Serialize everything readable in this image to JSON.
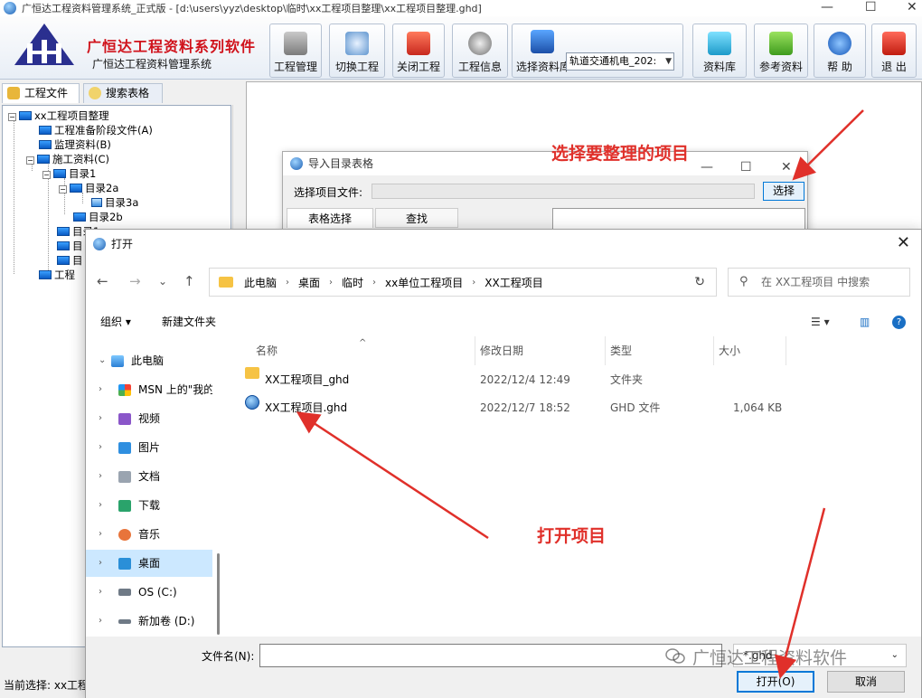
{
  "window": {
    "title": "广恒达工程资料管理系统_正式版 - [d:\\users\\yyz\\desktop\\临时\\xx工程项目整理\\xx工程项目整理.ghd]",
    "controls": [
      "—",
      "☐",
      "✕"
    ]
  },
  "brand": {
    "name": "广恒达工程资料系列软件",
    "subtitle": "广恒达工程资料管理系统"
  },
  "toolbar": {
    "project_mgmt": "工程管理",
    "switch_project": "切换工程",
    "close_project": "关闭工程",
    "project_info": "工程信息",
    "select_library": "选择资料库",
    "library_value": "轨道交通机电_202:",
    "library_btn": "资料库",
    "reference": "参考资料",
    "help": "帮 助",
    "exit": "退 出"
  },
  "left_tabs": {
    "project_files": "工程文件",
    "search_tables": "搜索表格"
  },
  "tree": {
    "root": "xx工程项目整理",
    "prep": "工程准备阶段文件(A)",
    "supervision": "监理资料(B)",
    "construction": "施工资料(C)",
    "dir1": "目录1",
    "dir2a": "目录2a",
    "dir3a": "目录3a",
    "dir2b": "目录2b",
    "dir_partial1": "目录1",
    "dir_partial2": "目",
    "dir_partial3": "目",
    "last_partial": "工程"
  },
  "status": {
    "current": "当前选择: xx工程"
  },
  "import_dialog": {
    "title": "导入目录表格",
    "file_label": "选择项目文件:",
    "select_button": "选择",
    "tab_select": "表格选择",
    "tab_find": "查找",
    "controls": [
      "—",
      "☐",
      "✕"
    ]
  },
  "annotations": {
    "select_project": "选择要整理的项目",
    "open_project": "打开项目"
  },
  "open_dialog": {
    "title": "打开",
    "close": "✕",
    "nav": {
      "back": "←",
      "forward": "→",
      "dropdown": "⌄",
      "up": "↑"
    },
    "breadcrumb": [
      "此电脑",
      "桌面",
      "临时",
      "xx单位工程项目",
      "XX工程项目"
    ],
    "breadcrumb_sep": "›",
    "refresh": "↻",
    "search_placeholder": "在 XX工程项目 中搜索",
    "search_icon": "⚲",
    "organize": "组织 ▾",
    "new_folder": "新建文件夹",
    "view_icons": [
      "☰ ▾",
      "▥",
      "?"
    ],
    "sidebar": [
      {
        "label": "此电脑",
        "chevron": "⌄",
        "icon": "pc"
      },
      {
        "label": "MSN 上的\"我的",
        "chevron": "›",
        "icon": "msn"
      },
      {
        "label": "视频",
        "chevron": "›",
        "icon": "video"
      },
      {
        "label": "图片",
        "chevron": "›",
        "icon": "pictures"
      },
      {
        "label": "文档",
        "chevron": "›",
        "icon": "docs"
      },
      {
        "label": "下载",
        "chevron": "›",
        "icon": "download"
      },
      {
        "label": "音乐",
        "chevron": "›",
        "icon": "music"
      },
      {
        "label": "桌面",
        "chevron": "›",
        "icon": "desktop"
      },
      {
        "label": "OS (C:)",
        "chevron": "›",
        "icon": "drive-c"
      },
      {
        "label": "新加卷 (D:)",
        "chevron": "›",
        "icon": "drive-d"
      }
    ],
    "columns": {
      "name": "名称",
      "modified": "修改日期",
      "type": "类型",
      "size": "大小"
    },
    "sort_indicator": "^",
    "files": [
      {
        "name": "XX工程项目_ghd",
        "modified": "2022/12/4 12:49",
        "type": "文件夹",
        "size": "",
        "icon": "folder"
      },
      {
        "name": "XX工程项目.ghd",
        "modified": "2022/12/7 18:52",
        "type": "GHD 文件",
        "size": "1,064 KB",
        "icon": "ghd-file"
      }
    ],
    "filename_label": "文件名(N):",
    "filename_value": "",
    "filter_value": "*.ghd",
    "open_button": "打开(O)",
    "cancel_button": "取消"
  },
  "watermark": {
    "text": "广恒达工程资料软件"
  },
  "colors": {
    "accent_red": "#e0302a",
    "brand_red": "#d0121b",
    "win_blue": "#0078d7",
    "selected_nav": "#cce8ff"
  }
}
